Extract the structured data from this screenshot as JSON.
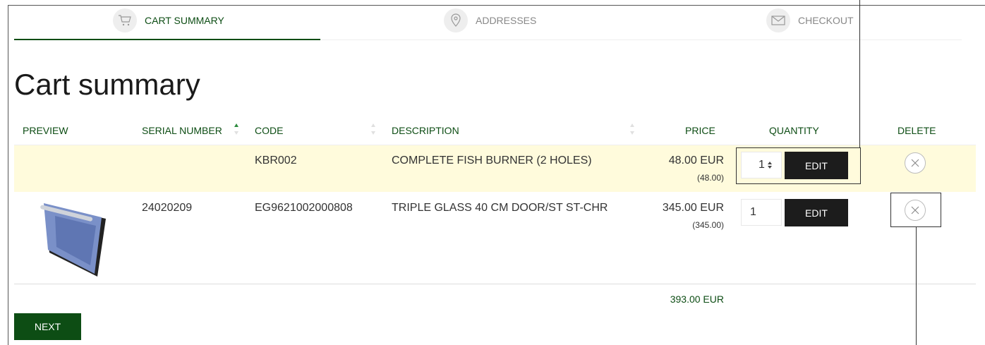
{
  "steps": [
    {
      "label": "CART SUMMARY",
      "icon": "cart-icon",
      "active": true
    },
    {
      "label": "ADDRESSES",
      "icon": "location-pin-icon",
      "active": false
    },
    {
      "label": "CHECKOUT",
      "icon": "envelope-icon",
      "active": false
    }
  ],
  "page_title": "Cart summary",
  "table": {
    "headers": {
      "preview": "PREVIEW",
      "serial_number": "SERIAL NUMBER",
      "code": "CODE",
      "description": "DESCRIPTION",
      "price": "PRICE",
      "quantity": "QUANTITY",
      "delete": "DELETE"
    },
    "rows": [
      {
        "serial_number": "",
        "code": "KBR002",
        "description": "COMPLETE FISH BURNER (2 HOLES)",
        "price": "48.00 EUR",
        "price_sub": "(48.00)",
        "quantity": "1",
        "edit_label": "EDIT",
        "highlighted": true
      },
      {
        "serial_number": "24020209",
        "code": "EG9621002000808",
        "description": "TRIPLE GLASS 40 CM DOOR/ST ST-CHR",
        "price": "345.00 EUR",
        "price_sub": "(345.00)",
        "quantity": "1",
        "edit_label": "EDIT",
        "highlighted": false
      }
    ],
    "total": "393.00 EUR"
  },
  "next_label": "NEXT",
  "colors": {
    "accent": "#0d4d14",
    "highlight_row": "#fffbdc",
    "edit_button": "#1c1c1c"
  }
}
